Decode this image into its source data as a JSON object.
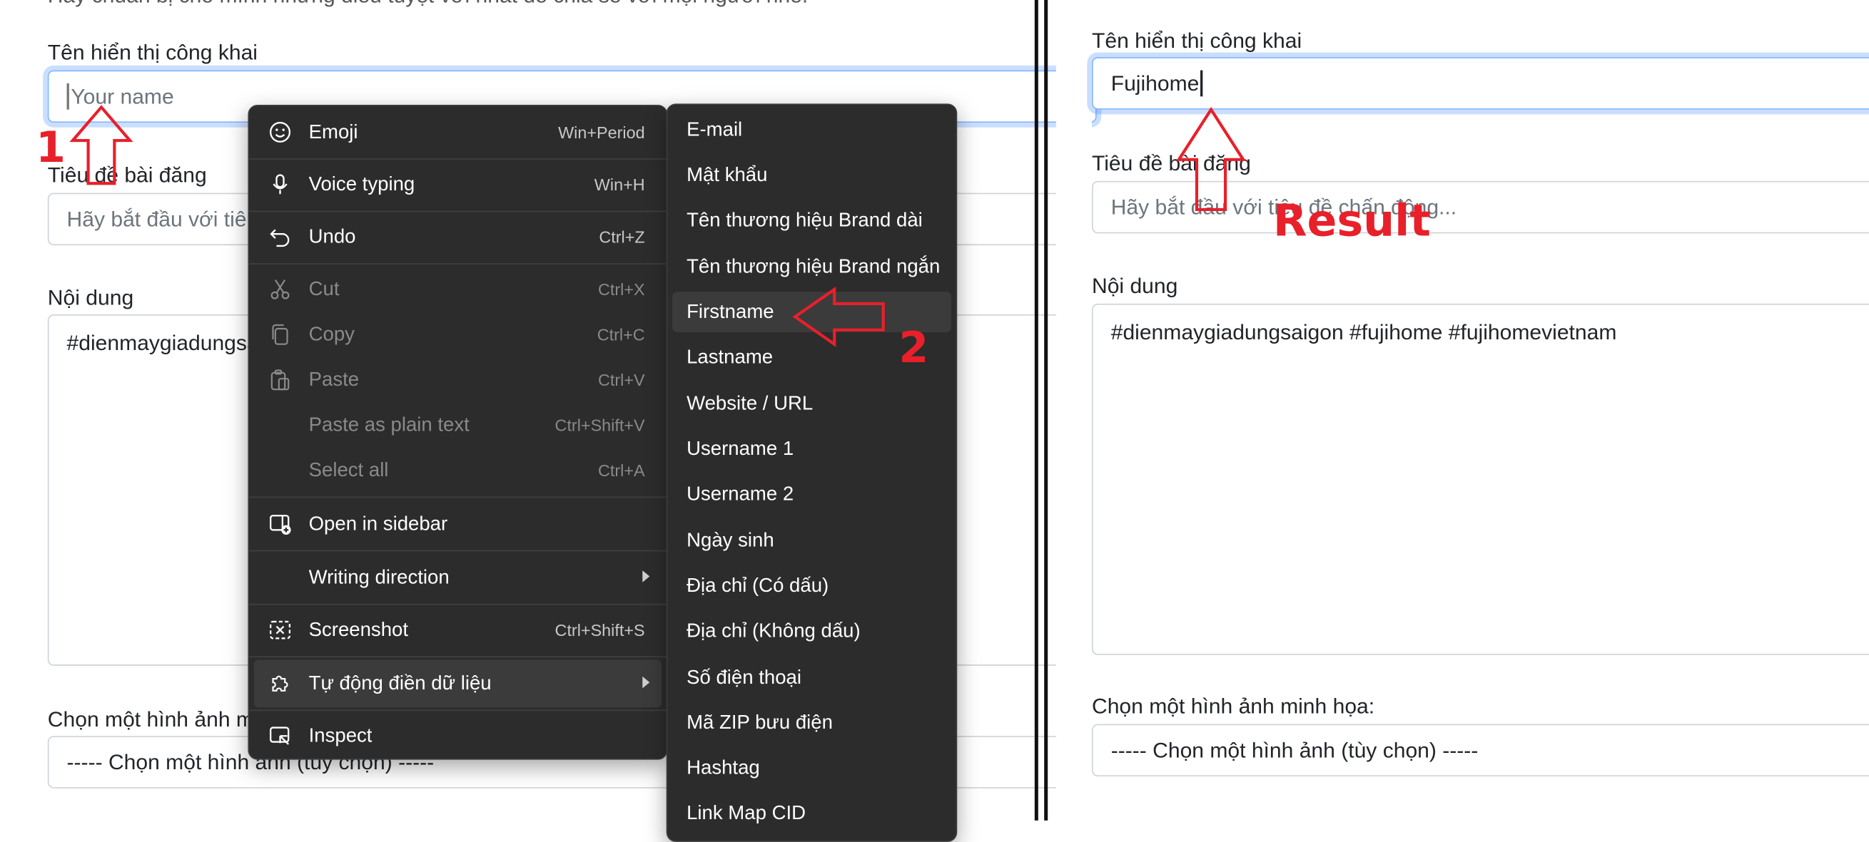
{
  "left_form": {
    "intro_text": "Hãy chuẩn bị cho mình những điều tuyệt vời nhất để chia sẻ với mọi người nhé.",
    "display_name_label": "Tên hiển thị công khai",
    "display_name_placeholder": "Your name",
    "post_title_label": "Tiêu đề bài đăng",
    "post_title_placeholder": "Hãy bắt đầu với tiêu đề",
    "content_label": "Nội dung",
    "content_value": "#dienmaygiadungsaigon #fujihome #fujihomevietnam",
    "image_label": "Chọn một hình ảnh minh họa:",
    "image_select_value": "----- Chọn một hình ảnh (tùy chọn) -----"
  },
  "context_menu": {
    "items": [
      {
        "icon": "emoji-icon",
        "label": "Emoji",
        "shortcut": "Win+Period",
        "disabled": false
      },
      {
        "icon": "microphone-icon",
        "label": "Voice typing",
        "shortcut": "Win+H",
        "disabled": false
      },
      {
        "icon": "undo-icon",
        "label": "Undo",
        "shortcut": "Ctrl+Z",
        "disabled": false
      },
      {
        "icon": "scissors-icon",
        "label": "Cut",
        "shortcut": "Ctrl+X",
        "disabled": true
      },
      {
        "icon": "copy-icon",
        "label": "Copy",
        "shortcut": "Ctrl+C",
        "disabled": true
      },
      {
        "icon": "paste-icon",
        "label": "Paste",
        "shortcut": "Ctrl+V",
        "disabled": true
      },
      {
        "icon": "",
        "label": "Paste as plain text",
        "shortcut": "Ctrl+Shift+V",
        "disabled": true
      },
      {
        "icon": "",
        "label": "Select all",
        "shortcut": "Ctrl+A",
        "disabled": true
      },
      {
        "icon": "sidebar-icon",
        "label": "Open in sidebar",
        "shortcut": "",
        "disabled": false
      },
      {
        "icon": "",
        "label": "Writing direction",
        "shortcut": "",
        "disabled": false,
        "submenu": true
      },
      {
        "icon": "screenshot-icon",
        "label": "Screenshot",
        "shortcut": "Ctrl+Shift+S",
        "disabled": false
      },
      {
        "icon": "puzzle-icon",
        "label": "Tự động điền dữ liệu",
        "shortcut": "",
        "disabled": false,
        "submenu": true,
        "highlighted": true
      },
      {
        "icon": "inspect-icon",
        "label": "Inspect",
        "shortcut": "",
        "disabled": false
      }
    ]
  },
  "submenu": {
    "items": [
      "E-mail",
      "Mật khẩu",
      "Tên thương hiệu Brand dài",
      "Tên thương hiệu Brand ngắn",
      "Firstname",
      "Lastname",
      "Website / URL",
      "Username 1",
      "Username 2",
      "Ngày sinh",
      "Địa chỉ (Có dấu)",
      "Địa chỉ (Không dấu)",
      "Số điện thoại",
      "Mã ZIP bưu điện",
      "Hashtag",
      "Link Map CID"
    ],
    "highlighted": "Firstname"
  },
  "right_form": {
    "display_name_label": "Tên hiển thị công khai",
    "display_name_value": "Fujihome",
    "post_title_label": "Tiêu đề bài đăng",
    "post_title_placeholder": "Hãy bắt đầu với tiêu đề chấn động...",
    "content_label": "Nội dung",
    "content_value": "#dienmaygiadungsaigon #fujihome #fujihomevietnam",
    "image_label": "Chọn một hình ảnh minh họa:",
    "image_select_value": "----- Chọn một hình ảnh (tùy chọn) -----"
  },
  "annotations": {
    "step1": "1",
    "step2": "2",
    "result": "Result",
    "color": "#e8202a"
  }
}
